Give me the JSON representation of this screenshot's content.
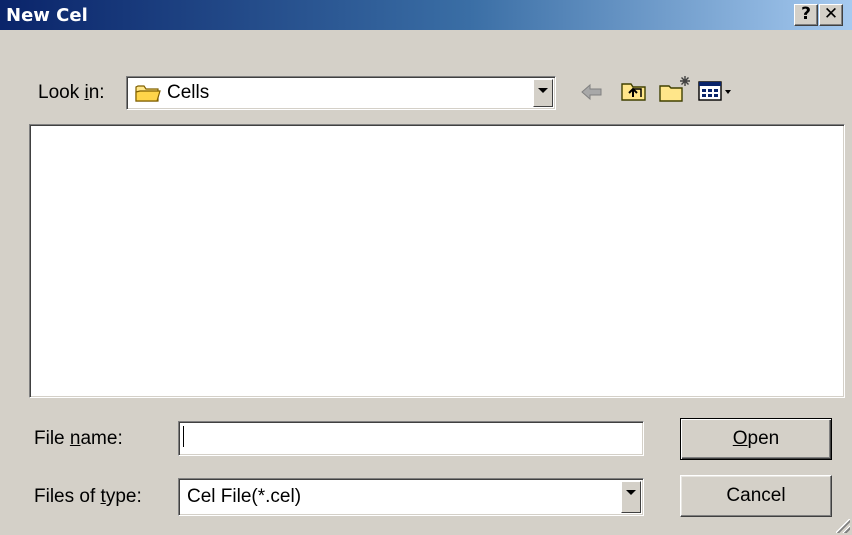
{
  "window": {
    "title": "New Cel",
    "help_label": "?",
    "close_label": "✕"
  },
  "look_in": {
    "label_pre": "Look ",
    "label_accel": "i",
    "label_post": "n:",
    "value": "Cells"
  },
  "toolbar": {
    "icons": [
      "back-arrow-icon",
      "up-folder-icon",
      "new-folder-icon",
      "view-menu-icon"
    ]
  },
  "file_name": {
    "label_pre": "File ",
    "label_accel": "n",
    "label_post": "ame:",
    "value": ""
  },
  "file_type": {
    "label_pre": "Files of ",
    "label_accel": "t",
    "label_post": "ype:",
    "value": "Cel File(*.cel)"
  },
  "buttons": {
    "open_accel": "O",
    "open_rest": "pen",
    "cancel": "Cancel"
  },
  "colors": {
    "title_start": "#0a246a",
    "title_end": "#a6caf0",
    "face": "#d4d0c8"
  }
}
